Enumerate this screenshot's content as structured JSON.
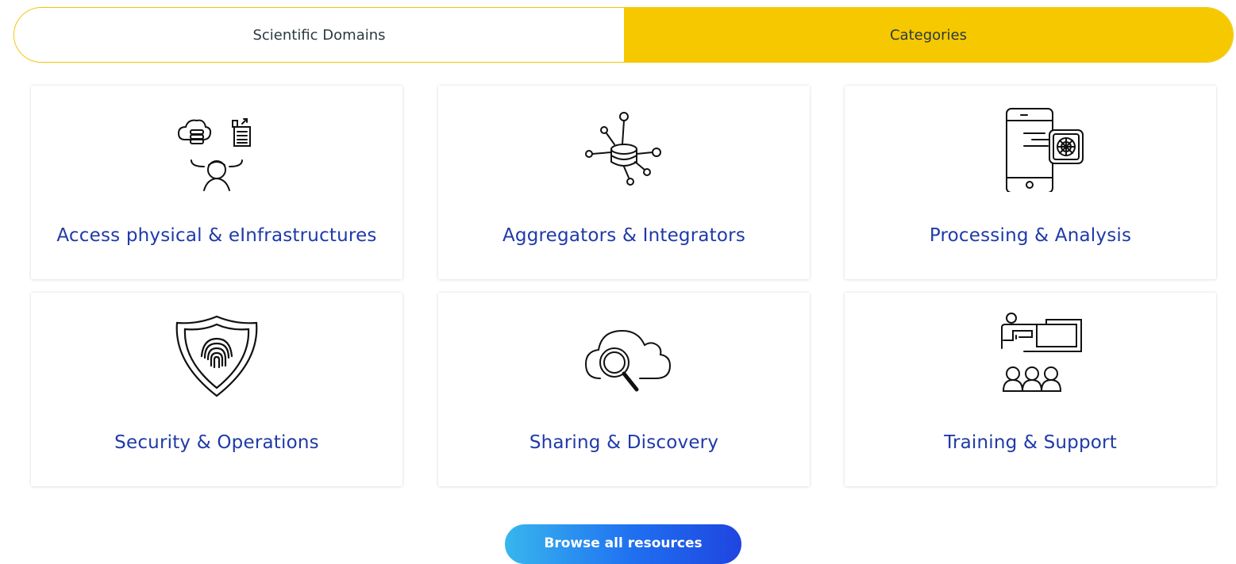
{
  "tabs": [
    {
      "label": "Scientific Domains"
    },
    {
      "label": "Categories"
    }
  ],
  "cards": [
    {
      "label": "Access physical & eInfrastructures",
      "icon": "infrastructure-icon"
    },
    {
      "label": "Aggregators & Integrators",
      "icon": "data-network-icon"
    },
    {
      "label": "Processing & Analysis",
      "icon": "mobile-processing-icon"
    },
    {
      "label": "Security & Operations",
      "icon": "fingerprint-shield-icon"
    },
    {
      "label": "Sharing & Discovery",
      "icon": "cloud-search-icon"
    },
    {
      "label": "Training & Support",
      "icon": "presentation-icon"
    }
  ],
  "browse_label": "Browse all resources",
  "colors": {
    "accent": "#f6c800",
    "link": "#1f3aa8",
    "button_start": "#37b6ee",
    "button_end": "#1f45e0"
  }
}
